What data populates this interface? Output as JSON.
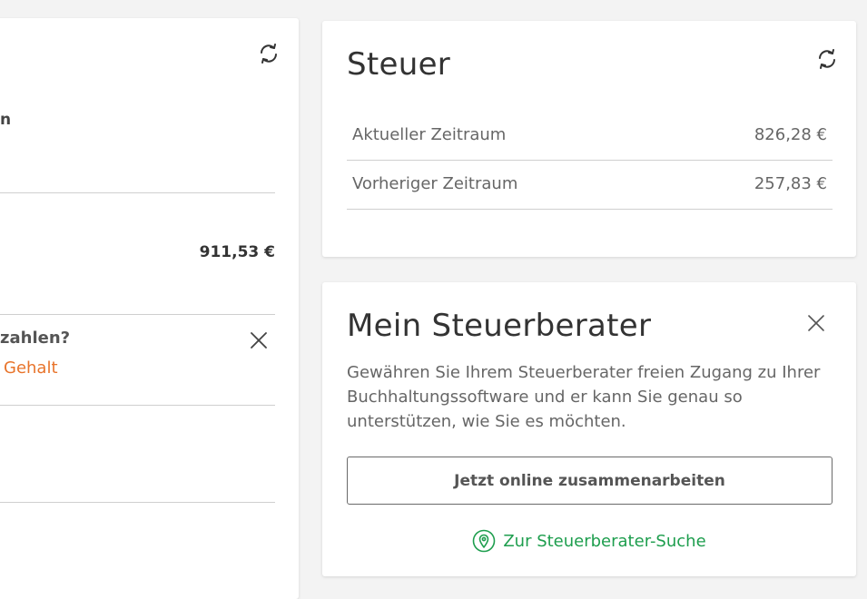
{
  "left_card": {
    "partial_heading": "n",
    "amount": "911,53 €",
    "question": "zahlen?",
    "link": "Gehalt",
    "icons": {
      "refresh": "refresh-icon",
      "close": "close-icon"
    }
  },
  "steuer_card": {
    "title": "Steuer",
    "rows": [
      {
        "label": "Aktueller Zeitraum",
        "value": "826,28 €"
      },
      {
        "label": "Vorheriger Zeitraum",
        "value": "257,83 €"
      }
    ],
    "icons": {
      "refresh": "refresh-icon"
    }
  },
  "berater_card": {
    "title": "Mein Steuerberater",
    "description": "Gewähren Sie Ihrem Steuerberater freien Zugang zu Ihrer Buchhaltungssoftware und er kann Sie genau so unterstützen, wie Sie es möchten.",
    "button_label": "Jetzt online zusammenarbeiten",
    "search_link": "Zur Steuerberater-Suche",
    "icons": {
      "close": "close-icon",
      "location": "location-pin-icon"
    }
  },
  "colors": {
    "accent_orange": "#e8742b",
    "accent_green": "#1e9e4e",
    "background": "#f3f3f3"
  }
}
